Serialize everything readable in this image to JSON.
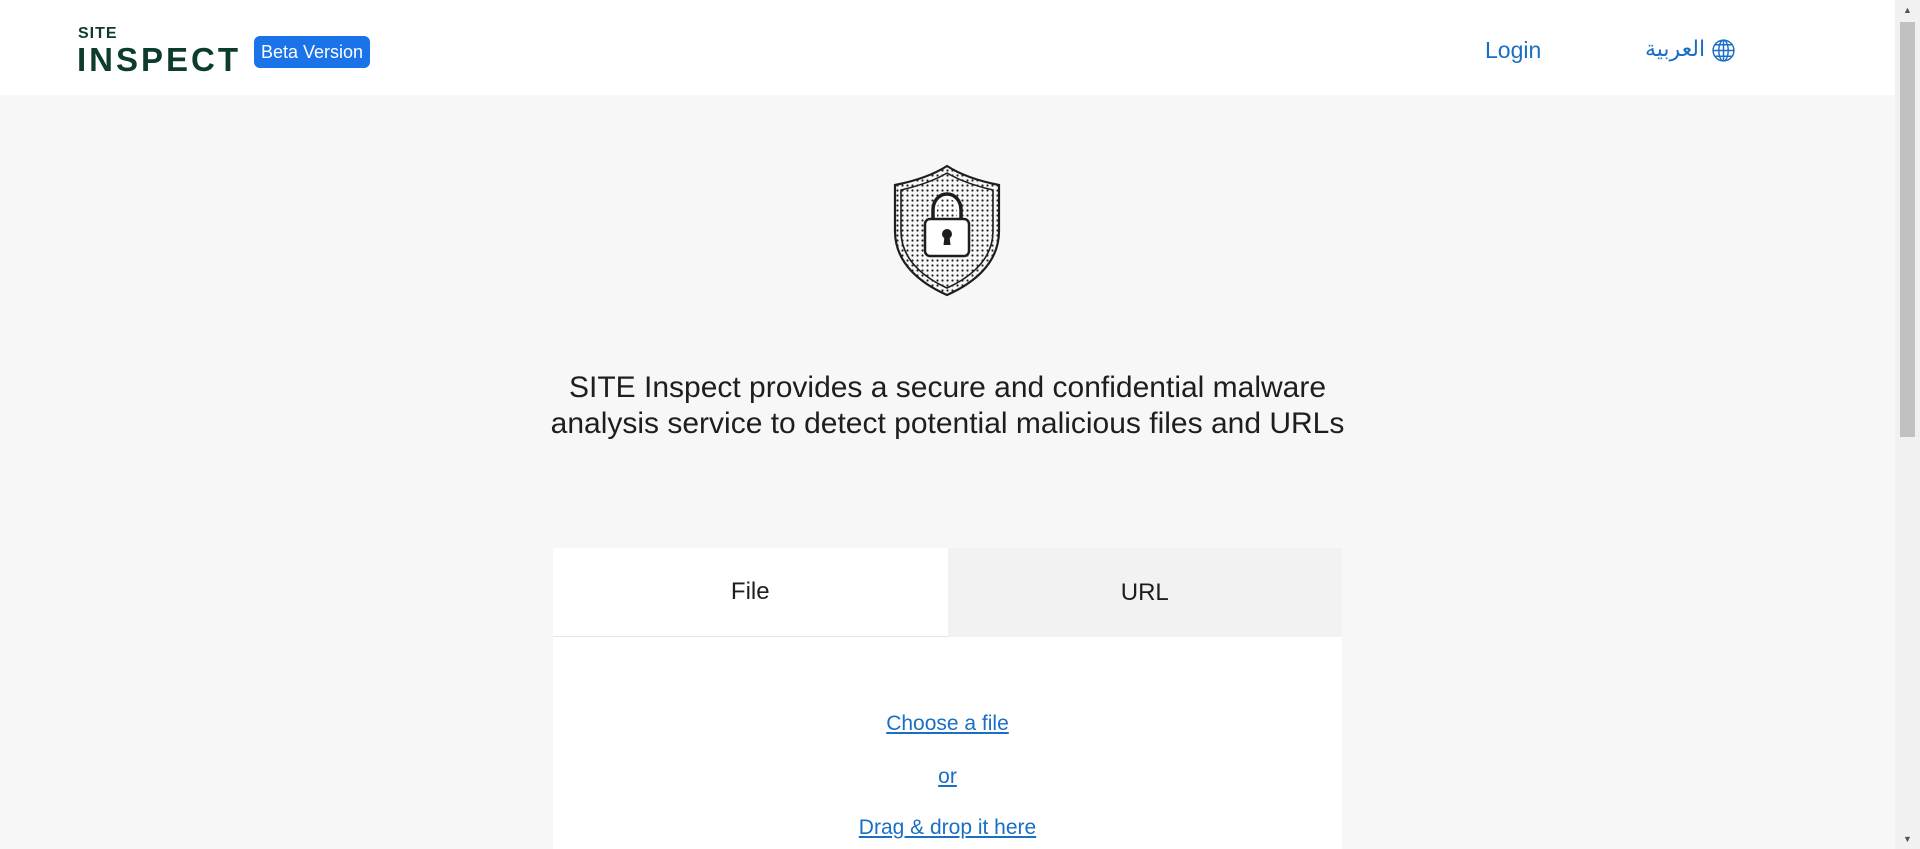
{
  "header": {
    "logo_top": "SITE",
    "logo_main": "INSPECT",
    "badge": "Beta Version",
    "login_label": "Login",
    "language_label": "العربية",
    "language_icon": "globe-icon"
  },
  "hero": {
    "icon": "shield-lock-icon",
    "headline": "SITE Inspect provides a secure and confidential malware analysis service to detect potential malicious files and URLs"
  },
  "scan_card": {
    "tabs": [
      {
        "label": "File",
        "active": true
      },
      {
        "label": "URL",
        "active": false
      }
    ],
    "choose_file_label": "Choose a file",
    "or_label": "or",
    "drag_drop_label": "Drag & drop it here"
  },
  "colors": {
    "brand_dark_green": "#0d3b2e",
    "accent_blue": "#1a73e8",
    "link_blue": "#1a6fc4",
    "page_background": "#f7f7f7"
  }
}
